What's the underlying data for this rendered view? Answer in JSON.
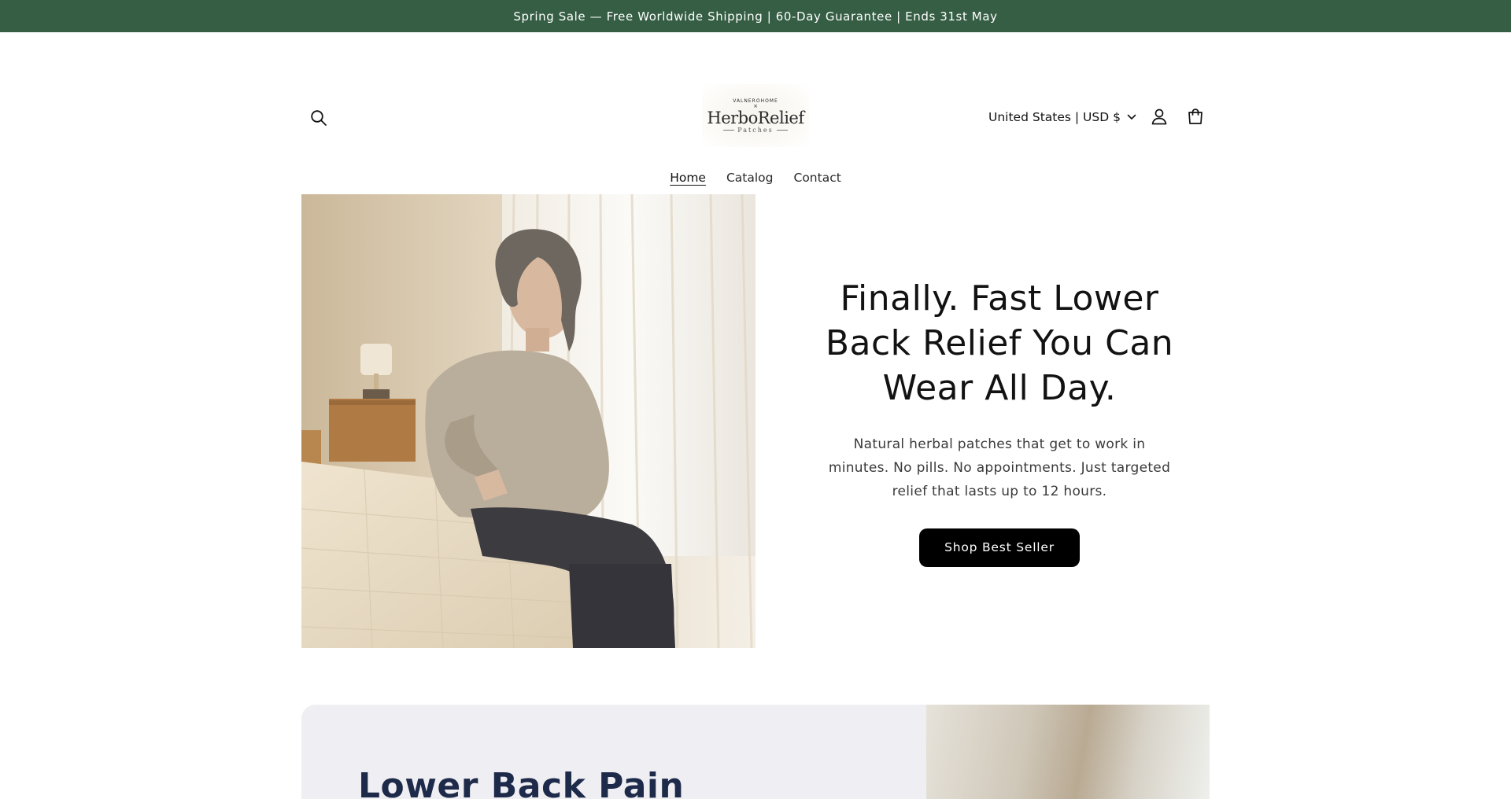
{
  "announcement": {
    "text": "Spring Sale — Free Worldwide Shipping | 60-Day Guarantee | Ends 31st May",
    "background": "#355e44"
  },
  "header": {
    "logo": {
      "brand_top": "VALNEROHOME",
      "separator": "×",
      "brand_main": "HerboRelief",
      "brand_sub": "Patches"
    },
    "localization_label": "United States | USD $",
    "icons": {
      "search": "search-icon",
      "account": "account-icon",
      "cart": "cart-icon",
      "dropdown": "chevron-down-icon"
    }
  },
  "nav": {
    "items": [
      {
        "label": "Home",
        "active": true
      },
      {
        "label": "Catalog",
        "active": false
      },
      {
        "label": "Contact",
        "active": false
      }
    ]
  },
  "hero": {
    "title": "Finally. Fast Lower Back Relief You Can Wear All Day.",
    "subtitle": "Natural herbal patches that get to work in minutes. No pills. No appointments. Just targeted relief that lasts up to 12 hours.",
    "cta_label": "Shop Best Seller",
    "cta_color": "#000000"
  },
  "next_section": {
    "title": "Lower Back Pain"
  }
}
